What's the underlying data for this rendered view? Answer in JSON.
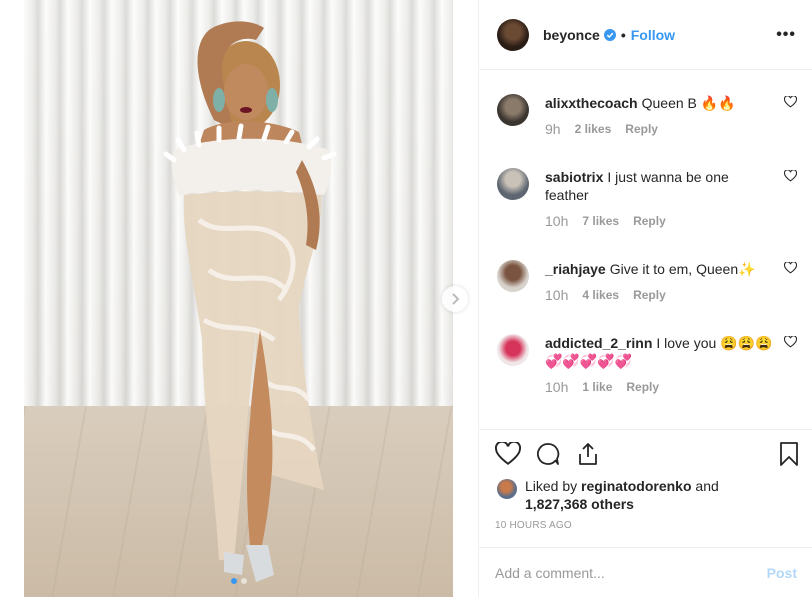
{
  "post": {
    "username": "beyonce",
    "follow_label": "Follow",
    "separator": "•",
    "more_label": "•••",
    "carousel_dots": 2,
    "active_dot": 0
  },
  "comments": [
    {
      "username": "alixxthecoach",
      "text": "Queen B 🔥🔥",
      "time": "9h",
      "likes": "2 likes",
      "reply": "Reply"
    },
    {
      "username": "sabiotrix",
      "text": "I just wanna be one feather",
      "time": "10h",
      "likes": "7 likes",
      "reply": "Reply"
    },
    {
      "username": "_riahjaye",
      "text": "Give it to em, Queen✨",
      "time": "10h",
      "likes": "4 likes",
      "reply": "Reply"
    },
    {
      "username": "addicted_2_rinn",
      "text": "I love you 😩😩😩💞💞💞💞💞",
      "time": "10h",
      "likes": "1 like",
      "reply": "Reply"
    }
  ],
  "likes": {
    "prefix": "Liked by",
    "user": "reginatodorenko",
    "conj": "and",
    "count": "1,827,368 others"
  },
  "timestamp": "10 HOURS AGO",
  "add_comment": {
    "placeholder": "Add a comment...",
    "post_label": "Post"
  },
  "colors": {
    "accent": "#3897f0",
    "muted": "#999999",
    "post_disabled": "#b3d8f9"
  }
}
